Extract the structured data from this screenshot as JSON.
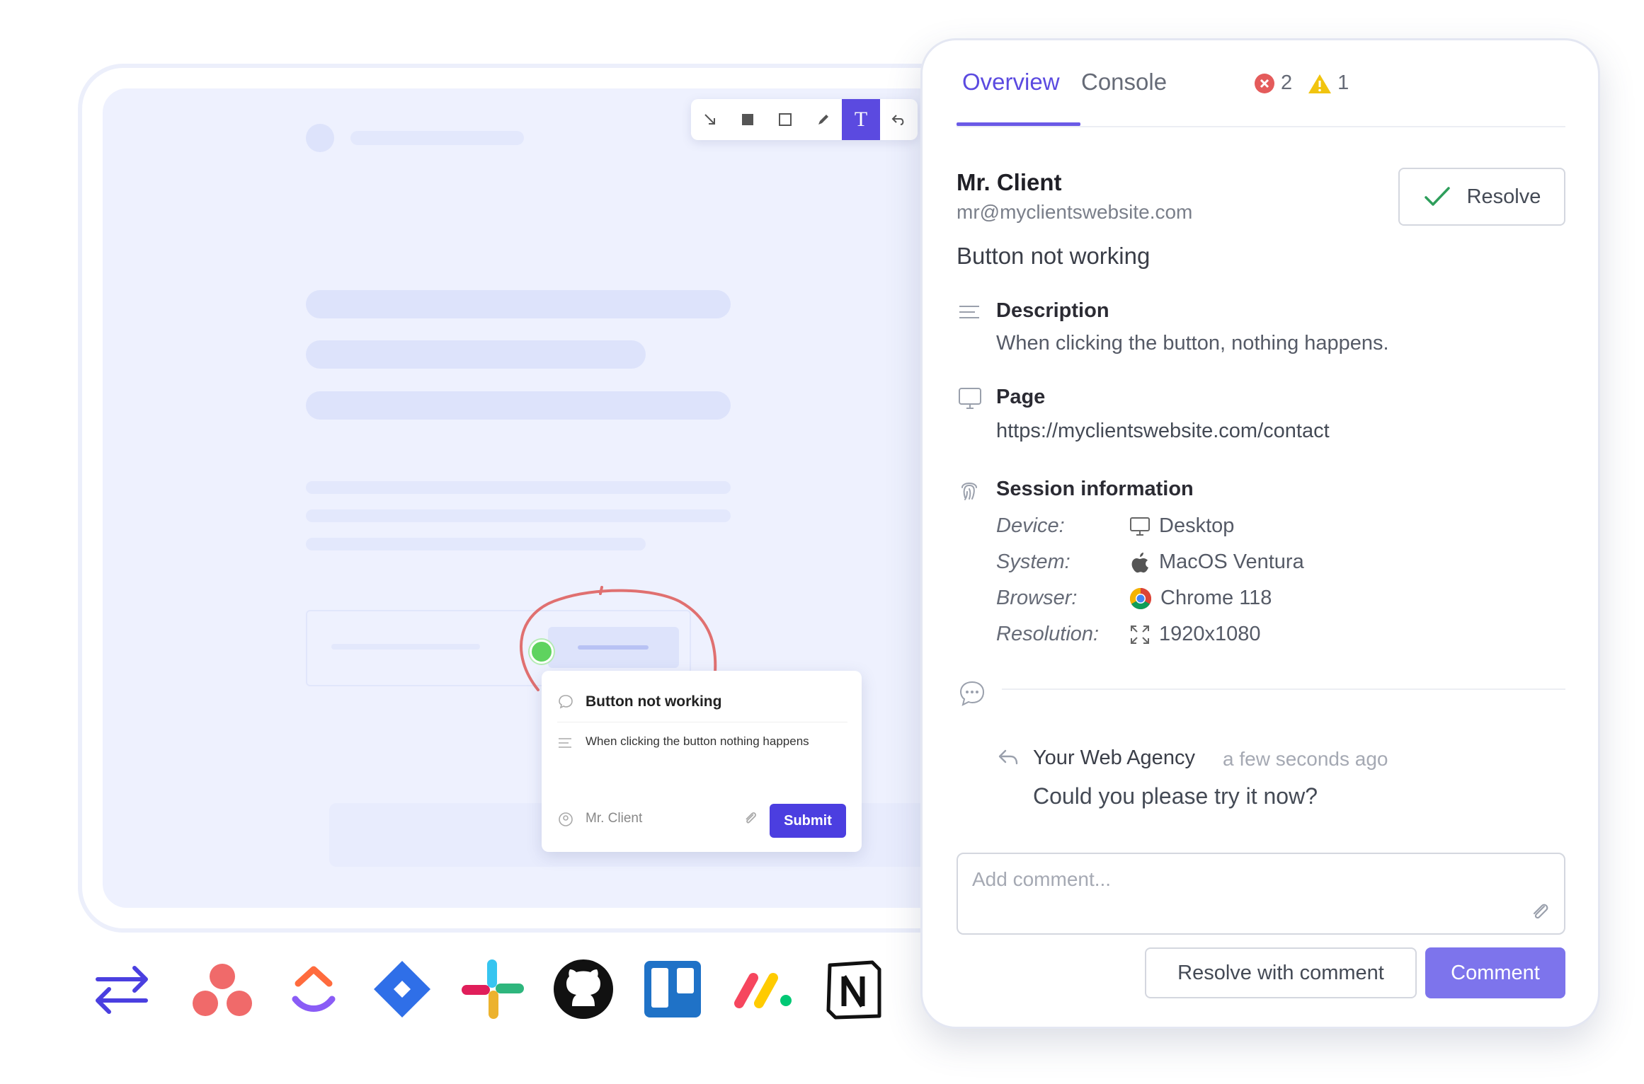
{
  "toolbar": {
    "tools": [
      "arrow-tool",
      "filled-rect-tool",
      "rect-tool",
      "pen-tool",
      "text-tool",
      "undo-tool"
    ],
    "active": "text-tool",
    "text_glyph": "T"
  },
  "mini_form": {
    "title": "Button not working",
    "description": "When clicking the button nothing happens",
    "author": "Mr. Client",
    "submit_label": "Submit"
  },
  "integrations": [
    "sync-icon",
    "asana-icon",
    "clickup-icon",
    "jira-icon",
    "slack-icon",
    "github-icon",
    "trello-icon",
    "monday-icon",
    "notion-icon"
  ],
  "panel": {
    "tabs": [
      {
        "label": "Overview",
        "active": true
      },
      {
        "label": "Console",
        "active": false
      }
    ],
    "console_errors": "2",
    "console_warnings": "1",
    "reporter_name": "Mr. Client",
    "reporter_email": "mr@myclientswebsite.com",
    "resolve_label": "Resolve",
    "issue_title": "Button not working",
    "description_label": "Description",
    "description_text": "When clicking the button, nothing happens.",
    "page_label": "Page",
    "page_url": "https://myclientswebsite.com/contact",
    "session_label": "Session information",
    "session": [
      {
        "key": "Device:",
        "value": "Desktop",
        "icon": "monitor-icon"
      },
      {
        "key": "System:",
        "value": "MacOS Ventura",
        "icon": "apple-icon"
      },
      {
        "key": "Browser:",
        "value": "Chrome 118",
        "icon": "chrome-icon"
      },
      {
        "key": "Resolution:",
        "value": "1920x1080",
        "icon": "expand-icon"
      }
    ],
    "reply_author": "Your Web Agency",
    "reply_time": "a few seconds ago",
    "reply_text": "Could you please try it now?",
    "comment_placeholder": "Add comment...",
    "resolve_with_comment_label": "Resolve with comment",
    "comment_label": "Comment"
  },
  "colors": {
    "accent": "#5b4ae0",
    "comment_button": "#7d74ec",
    "error": "#e45b5b",
    "warning": "#f1c40f",
    "check": "#2e9e5b"
  }
}
